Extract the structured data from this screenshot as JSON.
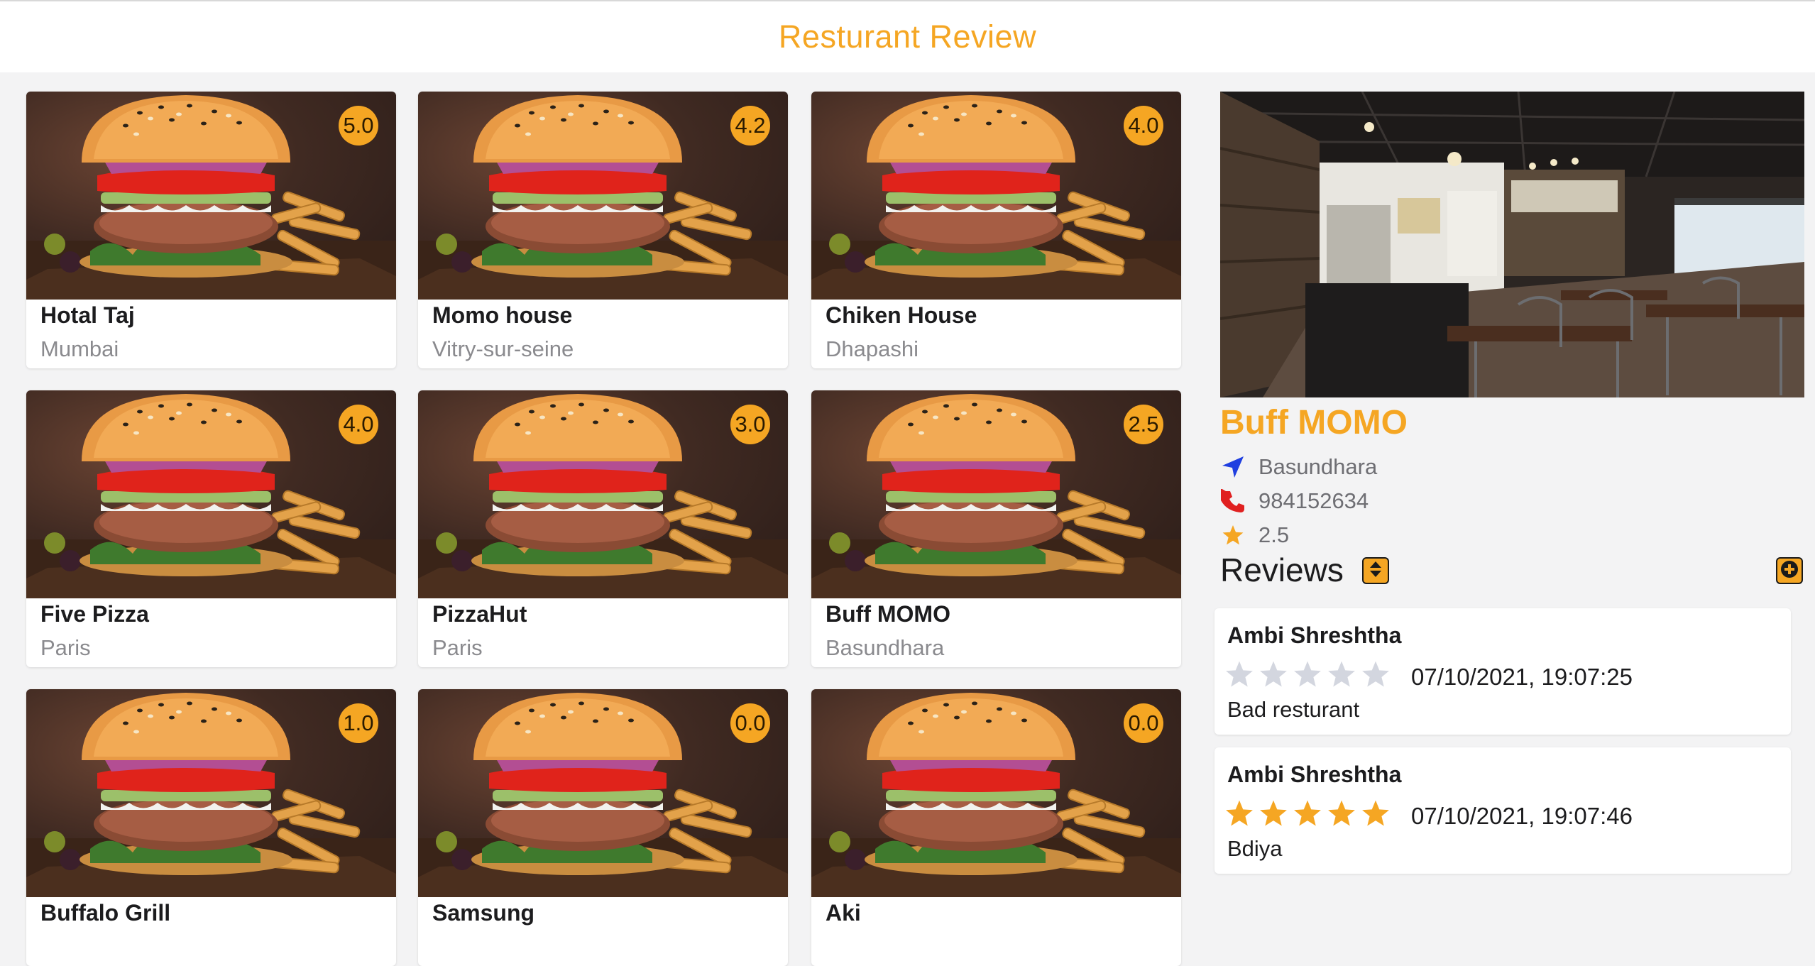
{
  "header": {
    "title": "Resturant Review"
  },
  "restaurants": [
    {
      "name": "Hotal Taj",
      "location": "Mumbai",
      "rating": "5.0"
    },
    {
      "name": "Momo house",
      "location": "Vitry-sur-seine",
      "rating": "4.2"
    },
    {
      "name": "Chiken House",
      "location": "Dhapashi",
      "rating": "4.0"
    },
    {
      "name": "Five Pizza",
      "location": "Paris",
      "rating": "4.0"
    },
    {
      "name": "PizzaHut",
      "location": "Paris",
      "rating": "3.0"
    },
    {
      "name": "Buff MOMO",
      "location": "Basundhara",
      "rating": "2.5"
    },
    {
      "name": "Buffalo Grill",
      "location": "",
      "rating": "1.0"
    },
    {
      "name": "Samsung",
      "location": "",
      "rating": "0.0"
    },
    {
      "name": "Aki",
      "location": "",
      "rating": "0.0"
    }
  ],
  "detail": {
    "name": "Buff MOMO",
    "address": "Basundhara",
    "phone": "984152634",
    "rating": "2.5",
    "icons": {
      "address": "location-arrow-icon",
      "phone": "phone-icon",
      "rating": "star-icon"
    },
    "reviews_heading": "Reviews",
    "sort_icon": "sort-icon",
    "add_icon": "plus-circle-icon",
    "reviews": [
      {
        "author": "Ambi Shreshtha",
        "stars": 0,
        "max_stars": 5,
        "time": "07/10/2021, 19:07:25",
        "text": "Bad resturant"
      },
      {
        "author": "Ambi Shreshtha",
        "stars": 5,
        "max_stars": 5,
        "time": "07/10/2021, 19:07:46",
        "text": "Bdiya"
      }
    ]
  },
  "colors": {
    "accent": "#f5a623",
    "star_empty": "#d3d6df",
    "location_icon": "#1f3fe0",
    "phone_icon": "#e02020"
  }
}
